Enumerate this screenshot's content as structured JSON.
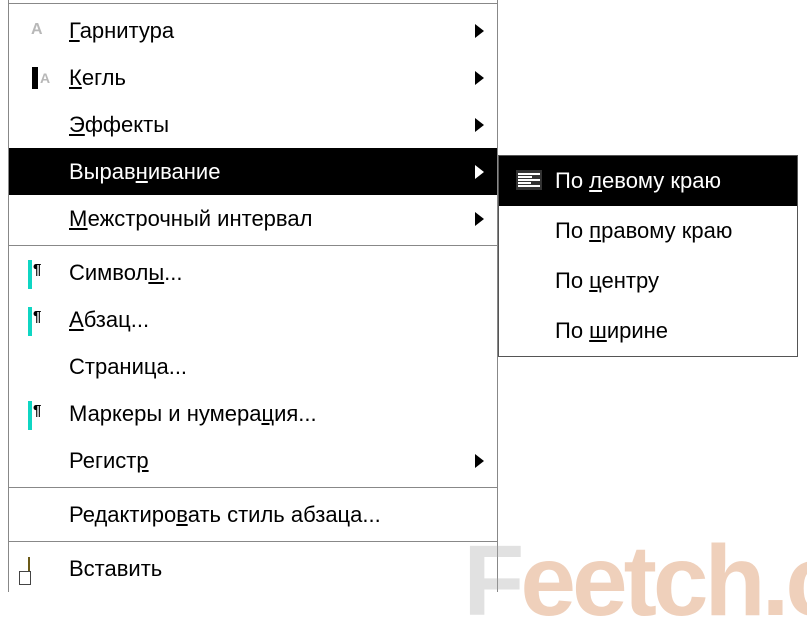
{
  "menu": {
    "items": [
      {
        "pre": "",
        "u": "Г",
        "post": "арнитура",
        "icon": "font-icon",
        "arrow": true
      },
      {
        "pre": "",
        "u": "К",
        "post": "егль",
        "icon": "size-icon",
        "arrow": true
      },
      {
        "pre": "",
        "u": "Э",
        "post": "ффекты",
        "icon": "",
        "arrow": true
      },
      {
        "pre": "Вырав",
        "u": "н",
        "post": "ивание",
        "icon": "",
        "arrow": true,
        "highlight": true
      },
      {
        "pre": "",
        "u": "М",
        "post": "ежстрочный интервал",
        "icon": "",
        "arrow": true
      },
      "---",
      {
        "pre": "Символ",
        "u": "ы",
        "post": "...",
        "icon": "paragraph-icon",
        "arrow": false
      },
      {
        "pre": "",
        "u": "А",
        "post": "бзац...",
        "icon": "paragraph-icon",
        "arrow": false
      },
      {
        "pre": "Страница...",
        "u": "",
        "post": "",
        "icon": "",
        "arrow": false
      },
      {
        "pre": "Маркеры и нумера",
        "u": "ц",
        "post": "ия...",
        "icon": "paragraph-icon",
        "arrow": false
      },
      {
        "pre": "Регист",
        "u": "р",
        "post": "",
        "icon": "",
        "arrow": true
      },
      "---",
      {
        "pre": "Редактиро",
        "u": "в",
        "post": "ать стиль абзаца...",
        "icon": "",
        "arrow": false
      },
      "---",
      {
        "pre": "Вставить",
        "u": "",
        "post": "",
        "icon": "paste-icon",
        "arrow": false
      }
    ]
  },
  "submenu": {
    "items": [
      {
        "pre": "По ",
        "u": "л",
        "post": "евому краю",
        "icon": "align-left-icon",
        "highlight": true
      },
      {
        "pre": "По ",
        "u": "п",
        "post": "равому краю",
        "icon": ""
      },
      {
        "pre": "По ",
        "u": "ц",
        "post": "ентру",
        "icon": ""
      },
      {
        "pre": "По ",
        "u": "ш",
        "post": "ирине",
        "icon": ""
      }
    ]
  },
  "watermark": {
    "lead": "F",
    "rest": "eetch.c"
  }
}
